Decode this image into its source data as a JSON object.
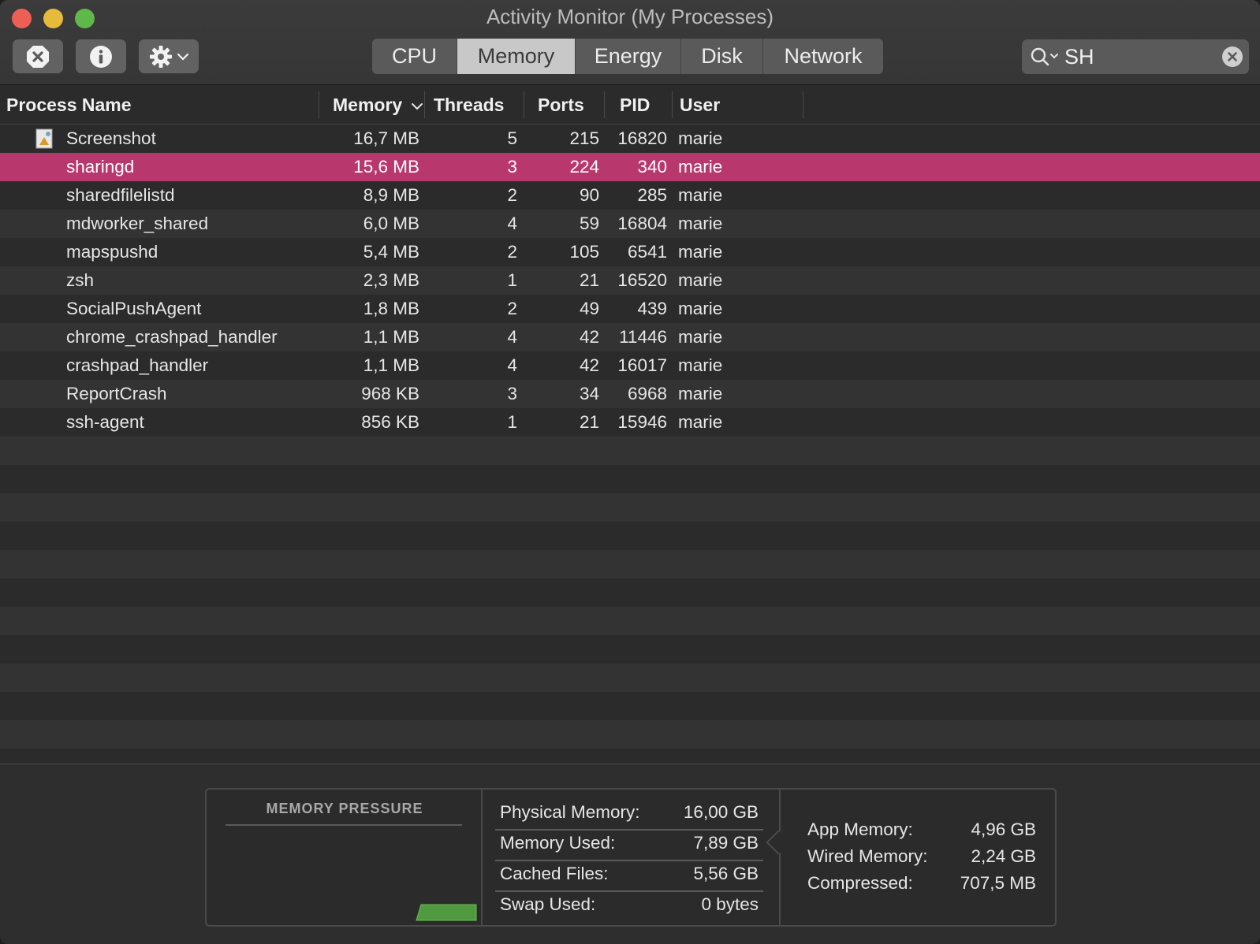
{
  "window": {
    "title": "Activity Monitor (My Processes)"
  },
  "toolbar": {
    "stop_icon": "stop-process-icon",
    "info_icon": "info-icon",
    "gear_icon": "gear-icon",
    "tabs": [
      "CPU",
      "Memory",
      "Energy",
      "Disk",
      "Network"
    ],
    "active_tab": "Memory",
    "search_value": "SH"
  },
  "table": {
    "headers": {
      "process_name": "Process Name",
      "memory": "Memory",
      "threads": "Threads",
      "ports": "Ports",
      "pid": "PID",
      "user": "User"
    },
    "sort_column": "Memory",
    "rows": [
      {
        "name": "Screenshot",
        "memory": "16,7 MB",
        "threads": "5",
        "ports": "215",
        "pid": "16820",
        "user": "marie",
        "has_icon": true
      },
      {
        "name": "sharingd",
        "memory": "15,6 MB",
        "threads": "3",
        "ports": "224",
        "pid": "340",
        "user": "marie",
        "selected": true
      },
      {
        "name": "sharedfilelistd",
        "memory": "8,9 MB",
        "threads": "2",
        "ports": "90",
        "pid": "285",
        "user": "marie"
      },
      {
        "name": "mdworker_shared",
        "memory": "6,0 MB",
        "threads": "4",
        "ports": "59",
        "pid": "16804",
        "user": "marie"
      },
      {
        "name": "mapspushd",
        "memory": "5,4 MB",
        "threads": "2",
        "ports": "105",
        "pid": "6541",
        "user": "marie"
      },
      {
        "name": "zsh",
        "memory": "2,3 MB",
        "threads": "1",
        "ports": "21",
        "pid": "16520",
        "user": "marie"
      },
      {
        "name": "SocialPushAgent",
        "memory": "1,8 MB",
        "threads": "2",
        "ports": "49",
        "pid": "439",
        "user": "marie"
      },
      {
        "name": "chrome_crashpad_handler",
        "memory": "1,1 MB",
        "threads": "4",
        "ports": "42",
        "pid": "11446",
        "user": "marie"
      },
      {
        "name": "crashpad_handler",
        "memory": "1,1 MB",
        "threads": "4",
        "ports": "42",
        "pid": "16017",
        "user": "marie"
      },
      {
        "name": "ReportCrash",
        "memory": "968 KB",
        "threads": "3",
        "ports": "34",
        "pid": "6968",
        "user": "marie"
      },
      {
        "name": "ssh-agent",
        "memory": "856 KB",
        "threads": "1",
        "ports": "21",
        "pid": "15946",
        "user": "marie"
      }
    ]
  },
  "memory_pressure": {
    "title": "MEMORY PRESSURE",
    "color": "#4f9a3f"
  },
  "memory_stats": [
    {
      "label": "Physical Memory:",
      "value": "16,00 GB"
    },
    {
      "label": "Memory Used:",
      "value": "7,89 GB"
    },
    {
      "label": "Cached Files:",
      "value": "5,56 GB"
    },
    {
      "label": "Swap Used:",
      "value": "0 bytes"
    }
  ],
  "memory_breakdown": [
    {
      "label": "App Memory:",
      "value": "4,96 GB"
    },
    {
      "label": "Wired Memory:",
      "value": "2,24 GB"
    },
    {
      "label": "Compressed:",
      "value": "707,5 MB"
    }
  ],
  "colors": {
    "selection": "#b8386e",
    "accent_active_tab": "#c8c8c8"
  }
}
